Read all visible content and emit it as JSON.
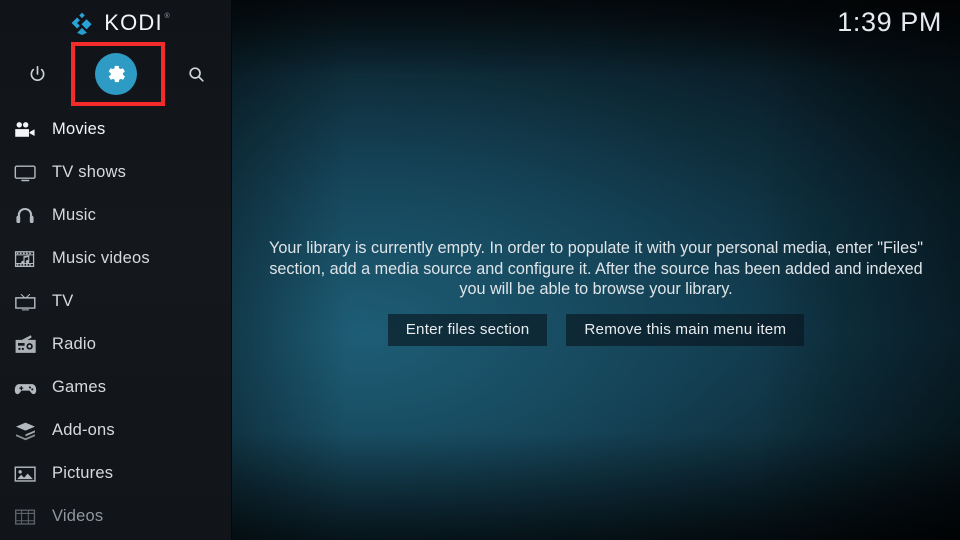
{
  "app": {
    "name": "KODI",
    "trademark": "®",
    "logo_icon": "kodi-logo-icon",
    "accent_color": "#2e9bc4",
    "annotation_color": "#f42b2b",
    "sidebar_bg": "#14181d",
    "content_bg": "#10384a"
  },
  "header": {
    "clock": "1:39 PM"
  },
  "top_icons": [
    {
      "name": "power-icon",
      "label": "Power",
      "active": false
    },
    {
      "name": "settings-gear-icon",
      "label": "Settings",
      "active": true,
      "highlighted": true
    },
    {
      "name": "search-icon",
      "label": "Search",
      "active": false
    }
  ],
  "sidebar": {
    "items": [
      {
        "label": "Movies",
        "icon": "movie-camera-icon",
        "state": "selected"
      },
      {
        "label": "TV shows",
        "icon": "television-icon",
        "state": "normal"
      },
      {
        "label": "Music",
        "icon": "headphones-icon",
        "state": "normal"
      },
      {
        "label": "Music videos",
        "icon": "film-note-icon",
        "state": "normal"
      },
      {
        "label": "TV",
        "icon": "tv-crt-icon",
        "state": "normal"
      },
      {
        "label": "Radio",
        "icon": "radio-icon",
        "state": "normal"
      },
      {
        "label": "Games",
        "icon": "gamepad-icon",
        "state": "normal"
      },
      {
        "label": "Add-ons",
        "icon": "addon-box-icon",
        "state": "normal"
      },
      {
        "label": "Pictures",
        "icon": "picture-icon",
        "state": "normal"
      },
      {
        "label": "Videos",
        "icon": "film-strip-icon",
        "state": "dim"
      }
    ]
  },
  "main": {
    "empty_message": "Your library is currently empty. In order to populate it with your personal media, enter \"Files\" section, add a media source and configure it. After the source has been added and indexed you will be able to browse your library.",
    "buttons": [
      {
        "label": "Enter files section",
        "name": "enter-files-section-button"
      },
      {
        "label": "Remove this main menu item",
        "name": "remove-main-menu-item-button"
      }
    ]
  }
}
